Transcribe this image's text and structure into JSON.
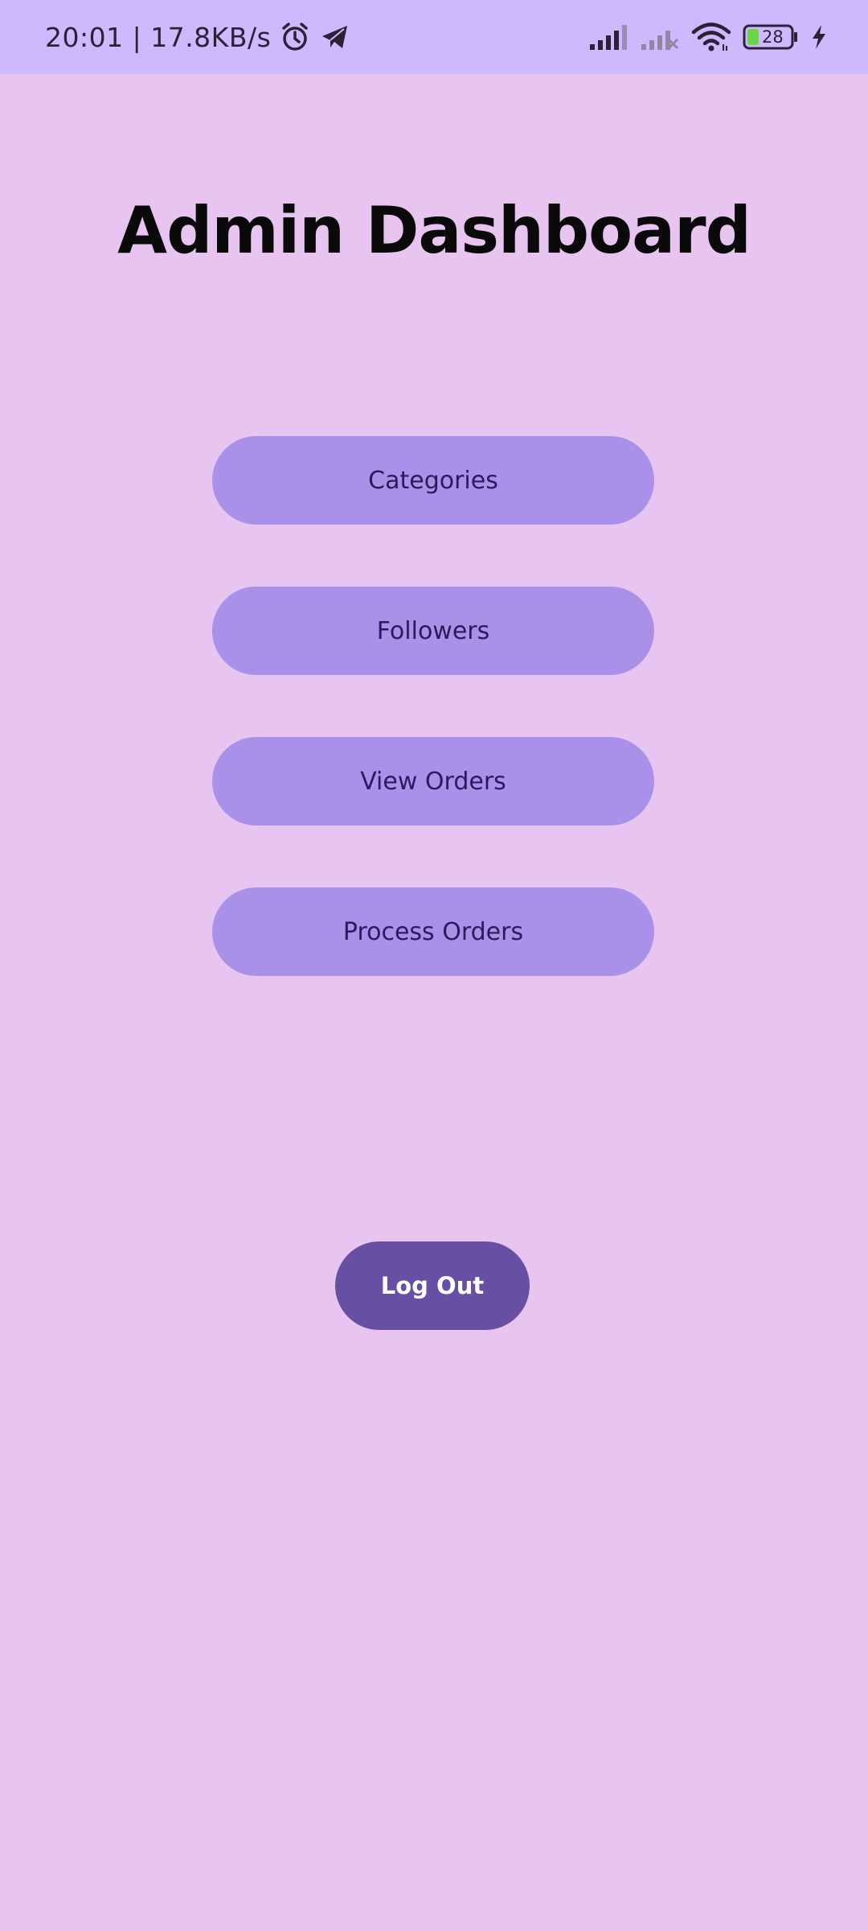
{
  "status_bar": {
    "time_speed": "20:01 | 17.8KB/s",
    "icons": [
      "alarm-icon",
      "telegram-icon",
      "signal-icon",
      "signal-off-icon",
      "wifi-icon",
      "battery-icon",
      "charging-icon"
    ],
    "battery_level": "28",
    "battery_color": "#6dd44a"
  },
  "header": {
    "title": "Admin Dashboard"
  },
  "menu": {
    "categories_label": "Categories",
    "followers_label": "Followers",
    "view_orders_label": "View Orders",
    "process_orders_label": "Process Orders"
  },
  "logout": {
    "label": "Log Out"
  },
  "colors": {
    "background": "#e8c5f0",
    "status_bar": "#d0b8fe",
    "menu_button": "#a991ea",
    "menu_button_text": "#2b1a5c",
    "logout_button": "#6750a4",
    "logout_text": "#ffffff"
  }
}
